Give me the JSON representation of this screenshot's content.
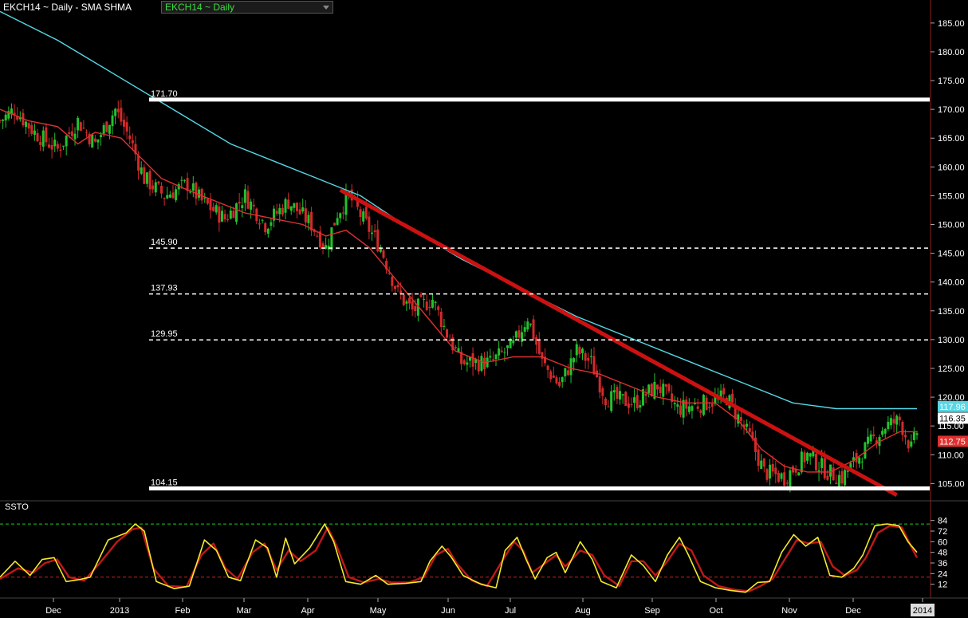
{
  "header": {
    "title": "EKCH14 ~ Daily  -  SMA SHMA",
    "dropdown_value": "EKCH14 ~ Daily"
  },
  "indicator_label": "SSTO",
  "colors": {
    "background": "#000000",
    "up_candle": "#22c22c",
    "down_candle": "#d22a2a",
    "sma_fast": "#e03030",
    "sma_slow": "#56d8e6",
    "trendline": "#cc1111",
    "level_solid": "#ffffff",
    "stoch_k": "#f2ea2a",
    "stoch_d": "#c01818",
    "stoch_upper": "#22cc22",
    "stoch_lower": "#cc2222"
  },
  "chart_data": {
    "type": "candlestick",
    "price_axis": {
      "min": 102,
      "max": 189,
      "ticks": [
        "185.00",
        "180.00",
        "175.00",
        "170.00",
        "165.00",
        "160.00",
        "155.00",
        "150.00",
        "145.00",
        "140.00",
        "135.00",
        "130.00",
        "125.00",
        "120.00",
        "115.00",
        "110.00",
        "105.00"
      ]
    },
    "time_axis": {
      "labels": [
        "Dec",
        "2013",
        "Feb",
        "Mar",
        "Apr",
        "May",
        "Jun",
        "Jul",
        "Aug",
        "Sep",
        "Oct",
        "Nov",
        "Dec",
        "2014"
      ]
    },
    "levels": [
      {
        "label": "171.70",
        "value": 171.7,
        "style": "solid"
      },
      {
        "label": "145.90",
        "value": 145.9,
        "style": "dashed"
      },
      {
        "label": "137.93",
        "value": 137.93,
        "style": "dashed"
      },
      {
        "label": "129.95",
        "value": 129.95,
        "style": "dashed"
      },
      {
        "label": "104.15",
        "value": 104.15,
        "style": "solid"
      }
    ],
    "price_badges": [
      {
        "label": "117.96",
        "value": 117.96,
        "color": "#56d8e6"
      },
      {
        "label": "116.35",
        "value": 116.35,
        "color": "#ffffff"
      },
      {
        "label": "112.75",
        "value": 112.75,
        "color": "#e03030"
      }
    ],
    "trendline": {
      "from": {
        "date": "May",
        "price": 156
      },
      "to": {
        "date": "2014",
        "price": 103
      }
    },
    "close_path": [
      [
        0,
        168
      ],
      [
        5,
        170
      ],
      [
        12,
        166
      ],
      [
        20,
        163
      ],
      [
        27,
        168
      ],
      [
        33,
        164
      ],
      [
        40,
        170
      ],
      [
        45,
        165
      ],
      [
        50,
        158
      ],
      [
        57,
        155
      ],
      [
        65,
        157
      ],
      [
        70,
        154
      ],
      [
        78,
        151
      ],
      [
        85,
        155
      ],
      [
        92,
        150
      ],
      [
        100,
        154
      ],
      [
        108,
        150
      ],
      [
        113,
        146
      ],
      [
        117,
        152
      ],
      [
        121,
        155
      ],
      [
        127,
        150
      ],
      [
        132,
        146
      ],
      [
        138,
        138
      ],
      [
        143,
        135
      ],
      [
        150,
        137
      ],
      [
        155,
        131
      ],
      [
        160,
        126
      ],
      [
        170,
        126
      ],
      [
        178,
        129
      ],
      [
        183,
        134
      ],
      [
        188,
        126
      ],
      [
        194,
        122
      ],
      [
        200,
        128
      ],
      [
        205,
        126
      ],
      [
        210,
        120
      ],
      [
        220,
        119
      ],
      [
        228,
        122
      ],
      [
        235,
        118
      ],
      [
        245,
        119
      ],
      [
        252,
        120
      ],
      [
        260,
        113
      ],
      [
        265,
        107
      ],
      [
        272,
        106
      ],
      [
        280,
        110
      ],
      [
        287,
        107
      ],
      [
        292,
        106
      ],
      [
        300,
        111
      ],
      [
        307,
        115
      ],
      [
        312,
        116
      ],
      [
        316,
        111
      ],
      [
        318,
        114
      ]
    ],
    "sma_fast_path": [
      [
        0,
        170
      ],
      [
        10,
        168
      ],
      [
        20,
        167
      ],
      [
        27,
        164
      ],
      [
        33,
        166
      ],
      [
        42,
        165
      ],
      [
        48,
        162
      ],
      [
        56,
        158
      ],
      [
        65,
        156
      ],
      [
        75,
        154
      ],
      [
        85,
        152
      ],
      [
        95,
        151
      ],
      [
        105,
        150
      ],
      [
        113,
        148
      ],
      [
        120,
        149
      ],
      [
        128,
        146
      ],
      [
        138,
        140
      ],
      [
        148,
        134
      ],
      [
        158,
        128
      ],
      [
        168,
        126
      ],
      [
        178,
        127
      ],
      [
        188,
        127
      ],
      [
        198,
        125
      ],
      [
        208,
        124
      ],
      [
        218,
        122
      ],
      [
        228,
        120
      ],
      [
        238,
        119
      ],
      [
        248,
        119
      ],
      [
        256,
        116
      ],
      [
        264,
        111
      ],
      [
        272,
        108
      ],
      [
        280,
        107
      ],
      [
        288,
        107
      ],
      [
        296,
        109
      ],
      [
        304,
        112
      ],
      [
        312,
        114
      ],
      [
        318,
        114
      ]
    ],
    "sma_slow_path": [
      [
        0,
        187
      ],
      [
        20,
        182
      ],
      [
        40,
        176
      ],
      [
        60,
        170
      ],
      [
        80,
        164
      ],
      [
        100,
        160
      ],
      [
        115,
        157
      ],
      [
        125,
        155
      ],
      [
        140,
        150
      ],
      [
        160,
        144
      ],
      [
        180,
        139
      ],
      [
        200,
        134
      ],
      [
        220,
        130
      ],
      [
        240,
        126
      ],
      [
        260,
        122
      ],
      [
        275,
        119
      ],
      [
        290,
        118
      ],
      [
        305,
        118
      ],
      [
        318,
        118
      ]
    ],
    "stochastic": {
      "name": "SSTO",
      "ticks": [
        "84",
        "72",
        "60",
        "48",
        "36",
        "24",
        "12"
      ],
      "upper": 80,
      "lower": 20,
      "k": [
        [
          0,
          20
        ],
        [
          5,
          38
        ],
        [
          10,
          22
        ],
        [
          14,
          40
        ],
        [
          18,
          42
        ],
        [
          22,
          15
        ],
        [
          26,
          17
        ],
        [
          30,
          20
        ],
        [
          36,
          62
        ],
        [
          42,
          70
        ],
        [
          45,
          80
        ],
        [
          48,
          72
        ],
        [
          52,
          15
        ],
        [
          58,
          7
        ],
        [
          63,
          10
        ],
        [
          68,
          62
        ],
        [
          72,
          50
        ],
        [
          76,
          20
        ],
        [
          80,
          16
        ],
        [
          85,
          62
        ],
        [
          89,
          53
        ],
        [
          92,
          20
        ],
        [
          95,
          64
        ],
        [
          98,
          35
        ],
        [
          103,
          53
        ],
        [
          108,
          80
        ],
        [
          111,
          60
        ],
        [
          115,
          15
        ],
        [
          120,
          12
        ],
        [
          125,
          22
        ],
        [
          129,
          12
        ],
        [
          135,
          13
        ],
        [
          140,
          15
        ],
        [
          143,
          38
        ],
        [
          147,
          55
        ],
        [
          150,
          43
        ],
        [
          154,
          22
        ],
        [
          160,
          12
        ],
        [
          165,
          8
        ],
        [
          168,
          50
        ],
        [
          172,
          65
        ],
        [
          175,
          40
        ],
        [
          178,
          18
        ],
        [
          182,
          42
        ],
        [
          185,
          48
        ],
        [
          188,
          25
        ],
        [
          193,
          60
        ],
        [
          197,
          40
        ],
        [
          200,
          15
        ],
        [
          205,
          8
        ],
        [
          210,
          45
        ],
        [
          214,
          33
        ],
        [
          218,
          15
        ],
        [
          222,
          45
        ],
        [
          226,
          65
        ],
        [
          229,
          45
        ],
        [
          233,
          15
        ],
        [
          238,
          8
        ],
        [
          243,
          5
        ],
        [
          248,
          3
        ],
        [
          252,
          14
        ],
        [
          256,
          15
        ],
        [
          260,
          48
        ],
        [
          264,
          68
        ],
        [
          268,
          55
        ],
        [
          272,
          65
        ],
        [
          276,
          22
        ],
        [
          280,
          20
        ],
        [
          284,
          30
        ],
        [
          287,
          45
        ],
        [
          291,
          78
        ],
        [
          295,
          80
        ],
        [
          299,
          78
        ],
        [
          302,
          60
        ],
        [
          305,
          48
        ]
      ],
      "d": [
        [
          0,
          18
        ],
        [
          6,
          30
        ],
        [
          11,
          25
        ],
        [
          15,
          36
        ],
        [
          19,
          40
        ],
        [
          23,
          20
        ],
        [
          28,
          16
        ],
        [
          33,
          35
        ],
        [
          39,
          60
        ],
        [
          44,
          74
        ],
        [
          47,
          76
        ],
        [
          51,
          30
        ],
        [
          56,
          10
        ],
        [
          62,
          9
        ],
        [
          67,
          45
        ],
        [
          71,
          58
        ],
        [
          75,
          30
        ],
        [
          79,
          18
        ],
        [
          84,
          48
        ],
        [
          88,
          58
        ],
        [
          92,
          28
        ],
        [
          96,
          50
        ],
        [
          100,
          38
        ],
        [
          105,
          50
        ],
        [
          109,
          76
        ],
        [
          112,
          55
        ],
        [
          116,
          20
        ],
        [
          121,
          14
        ],
        [
          126,
          18
        ],
        [
          130,
          14
        ],
        [
          136,
          14
        ],
        [
          141,
          20
        ],
        [
          145,
          45
        ],
        [
          149,
          52
        ],
        [
          152,
          35
        ],
        [
          157,
          16
        ],
        [
          162,
          10
        ],
        [
          167,
          38
        ],
        [
          171,
          60
        ],
        [
          174,
          50
        ],
        [
          177,
          25
        ],
        [
          181,
          35
        ],
        [
          185,
          45
        ],
        [
          188,
          32
        ],
        [
          193,
          50
        ],
        [
          197,
          45
        ],
        [
          201,
          22
        ],
        [
          206,
          10
        ],
        [
          210,
          38
        ],
        [
          214,
          38
        ],
        [
          218,
          22
        ],
        [
          222,
          38
        ],
        [
          226,
          58
        ],
        [
          230,
          50
        ],
        [
          234,
          22
        ],
        [
          239,
          10
        ],
        [
          244,
          6
        ],
        [
          249,
          4
        ],
        [
          253,
          10
        ],
        [
          257,
          18
        ],
        [
          261,
          40
        ],
        [
          265,
          62
        ],
        [
          269,
          58
        ],
        [
          273,
          60
        ],
        [
          277,
          32
        ],
        [
          281,
          22
        ],
        [
          285,
          28
        ],
        [
          288,
          42
        ],
        [
          292,
          70
        ],
        [
          296,
          78
        ],
        [
          300,
          76
        ],
        [
          303,
          55
        ],
        [
          305,
          42
        ]
      ]
    }
  }
}
